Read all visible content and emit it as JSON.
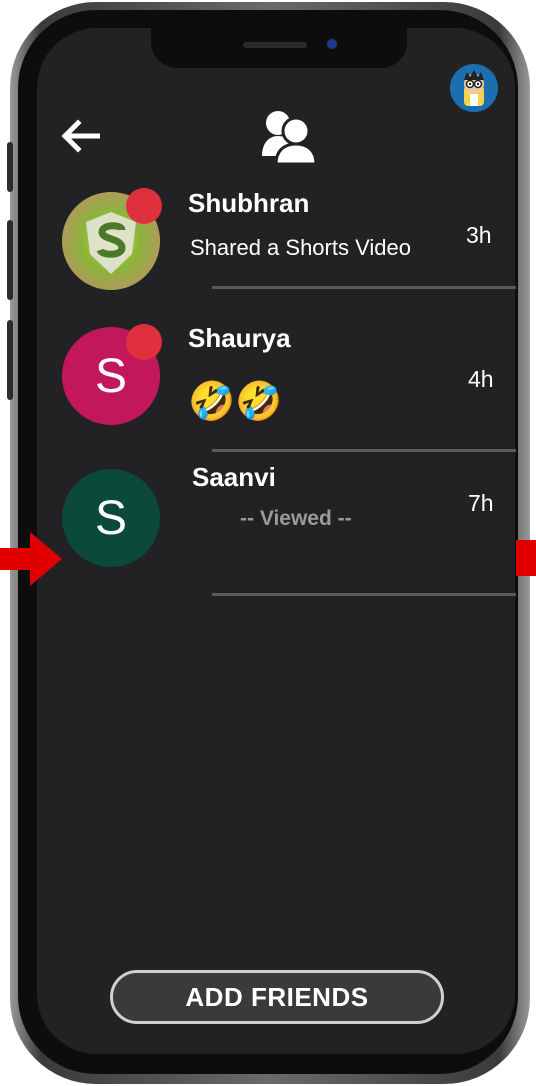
{
  "header": {
    "back_icon": "back-arrow-icon",
    "friends_icon": "friends-icon",
    "profile_icon": "profile-avatar"
  },
  "conversations": [
    {
      "name": "Shubhran",
      "message": "Shared a Shorts Video",
      "time": "3h",
      "avatar_type": "image",
      "unread": true
    },
    {
      "name": "Shaurya",
      "message": "🤣🤣",
      "time": "4h",
      "avatar_letter": "S",
      "avatar_color": "#c2185b",
      "unread": true
    },
    {
      "name": "Saanvi",
      "message": "-- Viewed --",
      "time": "7h",
      "avatar_letter": "S",
      "avatar_color": "#0b4a3a",
      "unread": false
    }
  ],
  "footer": {
    "add_friends_label": "ADD FRIENDS"
  },
  "colors": {
    "background": "#222224",
    "badge": "#e0303e",
    "annotation_arrow": "#e00000"
  }
}
